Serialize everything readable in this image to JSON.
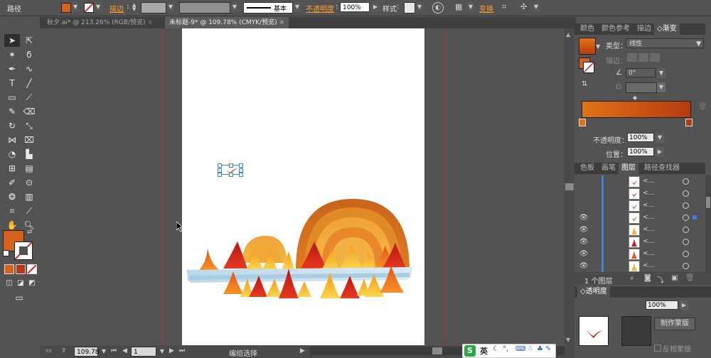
{
  "control_bar": {
    "object_type": "路径",
    "stroke_label": "描边",
    "stroke_style": "基本",
    "opacity_label": "不透明度",
    "opacity_value": "100%",
    "style_label": "样式",
    "transform_label": "变换",
    "fill_color": "#d4621a"
  },
  "tabs": [
    {
      "label": "秋夕.ai* @ 213.26% (RGB/预览)"
    },
    {
      "label": "未标题-9* @ 109.78% (CMYK/预览)"
    }
  ],
  "gradient_panel": {
    "tabs": [
      "颜色",
      "颜色参考",
      "描边",
      "渐变"
    ],
    "type_label": "类型",
    "type_value": "线性",
    "stroke_label": "描边",
    "angle_value": "0°",
    "opacity_label": "不透明度",
    "opacity_value": "100%",
    "location_label": "位置",
    "location_value": "100%",
    "gradient_from": "#e07317",
    "gradient_to": "#b53b0f"
  },
  "layers_panel": {
    "tabs": [
      "色板",
      "画笔",
      "图层",
      "路径查找器"
    ],
    "rows": [
      {
        "label": "<...",
        "thumb": "bird",
        "eye": false
      },
      {
        "label": "<...",
        "thumb": "bird",
        "eye": false
      },
      {
        "label": "<...",
        "thumb": "bird",
        "eye": false
      },
      {
        "label": "<...",
        "thumb": "bird",
        "eye": true,
        "selected": true
      },
      {
        "label": "<...",
        "thumb": "yellow",
        "eye": true
      },
      {
        "label": "<...",
        "thumb": "red",
        "eye": true
      },
      {
        "label": "<...",
        "thumb": "orange",
        "eye": true
      },
      {
        "label": "<...",
        "thumb": "yellow",
        "eye": true
      }
    ],
    "count_label": "1 个图层"
  },
  "transparency_panel": {
    "title": "透明度",
    "opacity_value": "100%",
    "make_mask_label": "制作蒙版",
    "invert_mask_label": "反相蒙版"
  },
  "status_bar": {
    "zoom": "109.78",
    "page": "1",
    "tool_status": "编组选择"
  },
  "ime_bar": {
    "logo": "S",
    "mode": "英"
  }
}
